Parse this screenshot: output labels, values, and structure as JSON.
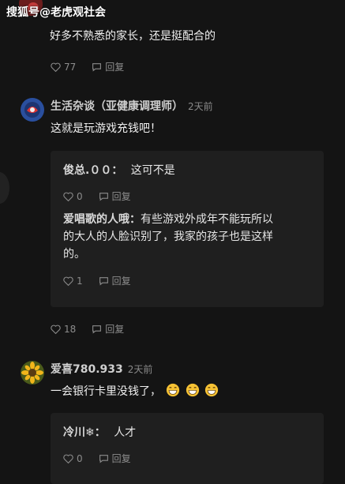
{
  "watermark": "搜狐号@老虎观社会",
  "comment1": {
    "text": "好多不熟悉的家长，还是挺配合的",
    "likes": "77",
    "reply_label": "回复"
  },
  "comment2": {
    "author": "生活杂谈（亚健康调理师）",
    "time": "2天前",
    "text": "这就是玩游戏充钱吧！",
    "likes": "18",
    "reply_label": "回复",
    "replies": [
      {
        "author": "俊总.００：",
        "text": "这可不是",
        "likes": "0",
        "reply_label": "回复"
      },
      {
        "author": "爱唱歌的人哦：",
        "text_lines": [
          "有些游戏外成年不能玩所以",
          "的大人的人脸识别了，我家的孩子也是这样",
          "的。"
        ],
        "likes": "1",
        "reply_label": "回复"
      }
    ]
  },
  "comment3": {
    "author": "爱喜780.933",
    "time": "2天前",
    "text": "一会银行卡里没钱了，",
    "replies": [
      {
        "author": "冷川❄：",
        "text": "人才",
        "likes": "0",
        "reply_label": "回复"
      }
    ]
  },
  "colors": {
    "background": "#141414",
    "reply_box": "#1f1f1f",
    "text": "#f0f0f0",
    "muted": "#8c8c8c"
  },
  "icons": [
    "heart-icon",
    "reply-icon",
    "grin-emoji-icon",
    "avatar"
  ]
}
